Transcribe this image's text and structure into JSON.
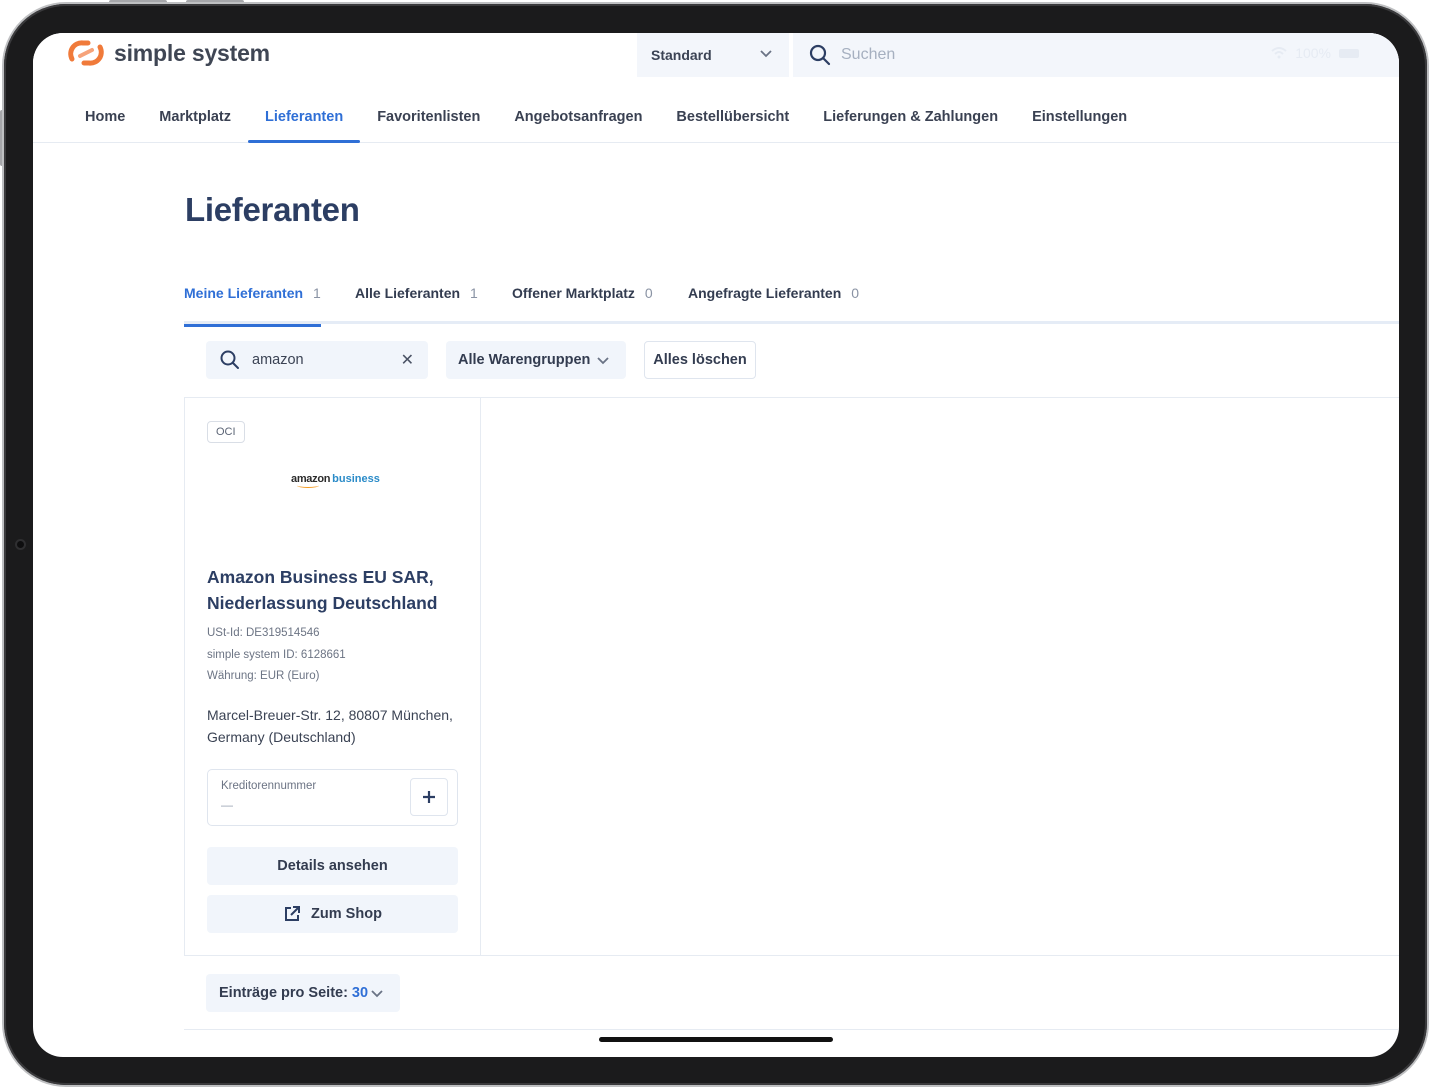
{
  "brand": {
    "name": "simple system"
  },
  "header": {
    "catalog_select": "Standard",
    "search_placeholder": "Suchen",
    "status_text": "100%"
  },
  "nav": {
    "items": [
      {
        "label": "Home",
        "active": false
      },
      {
        "label": "Marktplatz",
        "active": false
      },
      {
        "label": "Lieferanten",
        "active": true
      },
      {
        "label": "Favoritenlisten",
        "active": false
      },
      {
        "label": "Angebotsanfragen",
        "active": false
      },
      {
        "label": "Bestellübersicht",
        "active": false
      },
      {
        "label": "Lieferungen & Zahlungen",
        "active": false
      },
      {
        "label": "Einstellungen",
        "active": false
      }
    ]
  },
  "page": {
    "title": "Lieferanten"
  },
  "tabs": [
    {
      "label": "Meine Lieferanten",
      "count": "1",
      "active": true
    },
    {
      "label": "Alle Lieferanten",
      "count": "1",
      "active": false
    },
    {
      "label": "Offener Marktplatz",
      "count": "0",
      "active": false
    },
    {
      "label": "Angefragte Lieferanten",
      "count": "0",
      "active": false
    }
  ],
  "filters": {
    "search_value": "amazon",
    "category_select": "Alle Warengruppen",
    "clear_all": "Alles löschen"
  },
  "supplier": {
    "badge": "OCI",
    "logo_word1": "amazon",
    "logo_word2": "business",
    "name": "Amazon Business EU SAR, Niederlassung Deutschland",
    "vat_id": "USt-Id: DE319514546",
    "system_id": "simple system ID: 6128661",
    "currency": "Währung: EUR (Euro)",
    "address": "Marcel-Breuer-Str. 12, 80807 München, Germany (Deutschland)",
    "creditor_label": "Kreditorennummer",
    "creditor_value": "—",
    "details_button": "Details ansehen",
    "shop_button": "Zum Shop"
  },
  "pagination": {
    "per_page_label": "Einträge pro Seite:",
    "per_page_value": "30"
  },
  "colors": {
    "accent": "#2f6fd6",
    "heading": "#2c3e63",
    "logo_orange": "#f07a3a"
  }
}
